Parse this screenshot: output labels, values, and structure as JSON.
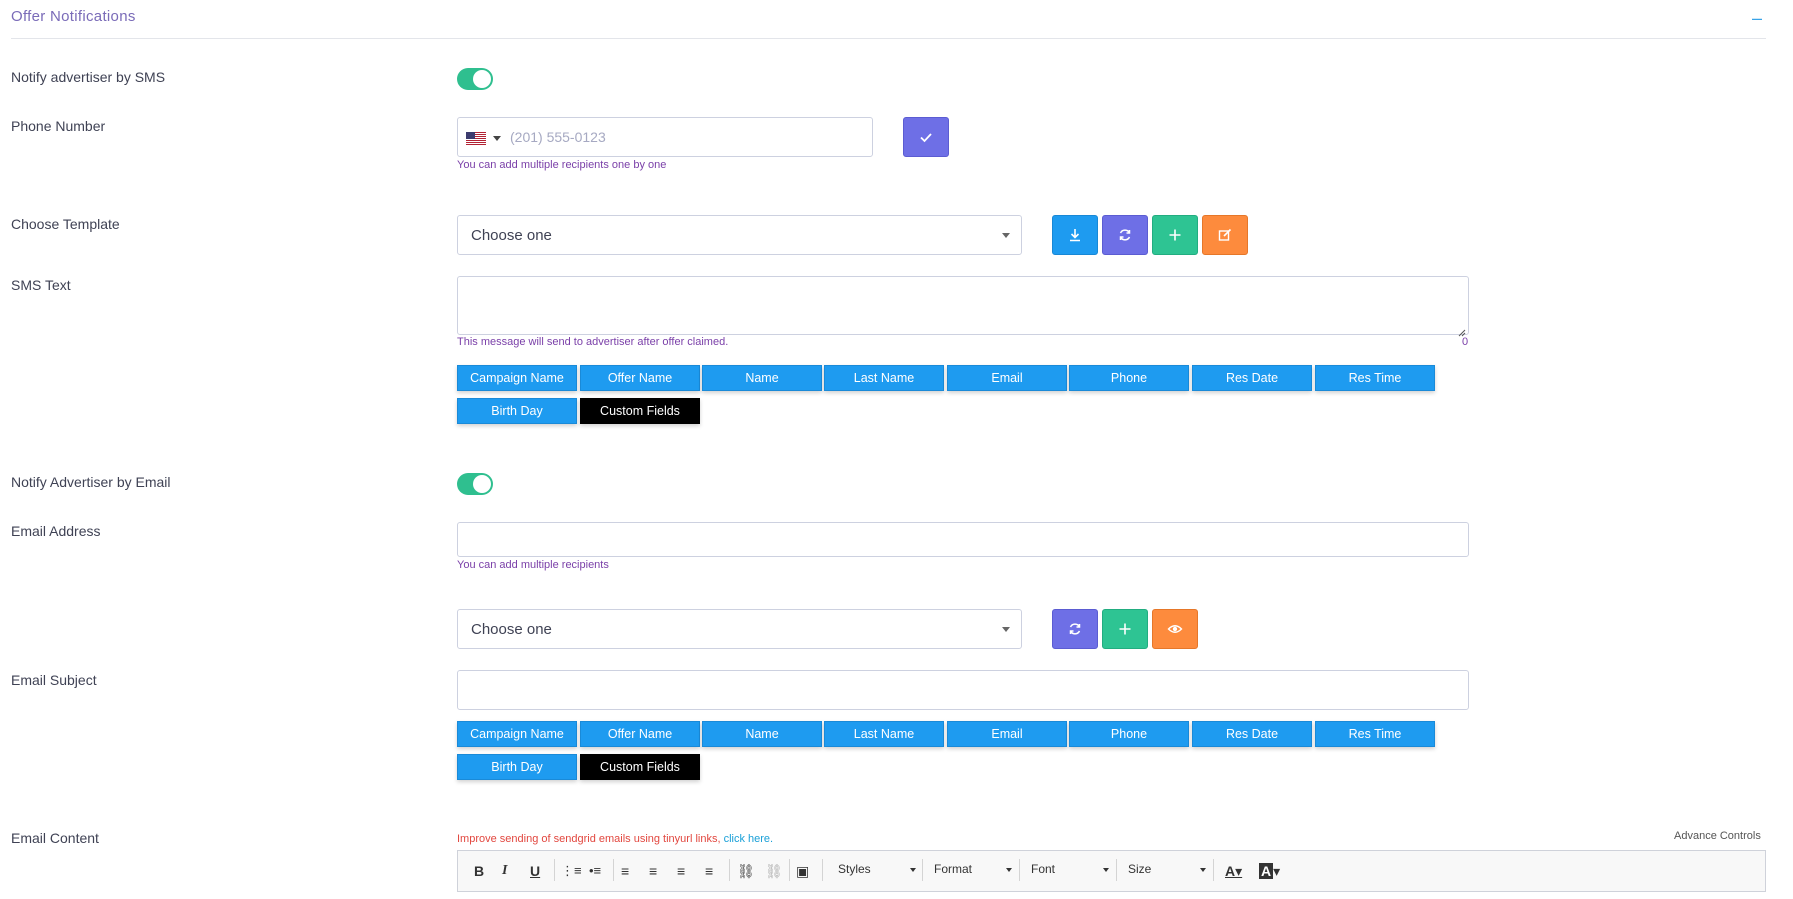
{
  "section": {
    "title": "Offer Notifications",
    "collapse_symbol": "–"
  },
  "sms": {
    "notify_label": "Notify advertiser by SMS",
    "notify_enabled": true,
    "phone_label": "Phone Number",
    "phone_placeholder": "(201) 555-0123",
    "phone_hint": "You can add multiple recipients one by one",
    "template_label": "Choose Template",
    "template_value": "Choose one",
    "text_label": "SMS Text",
    "text_value": "",
    "text_hint": "This message will send to advertiser after offer claimed.",
    "char_count": "0"
  },
  "tokens_row1": [
    "Campaign Name",
    "Offer Name",
    "Name",
    "Last Name",
    "Email",
    "Phone",
    "Res Date",
    "Res Time"
  ],
  "tokens_row2": [
    "Birth Day",
    "Custom Fields"
  ],
  "email": {
    "notify_label": "Notify Advertiser by Email",
    "notify_enabled": true,
    "address_label": "Email Address",
    "address_value": "",
    "address_hint": "You can add multiple recipients",
    "template_value": "Choose one",
    "subject_label": "Email Subject",
    "subject_value": "",
    "content_label": "Email Content",
    "tinyurl_notice": "Improve sending of sendgrid emails using tinyurl links,",
    "tinyurl_link": "click here.",
    "advance_controls": "Advance Controls"
  },
  "editor_toolbar": {
    "styles": "Styles",
    "format": "Format",
    "font": "Font",
    "size": "Size"
  },
  "colors": {
    "accent_blue": "#1e9bf0",
    "purple": "#6e6fe6",
    "green": "#2ec493",
    "orange": "#fd8b3d",
    "toggle_on": "#2fbf8f"
  }
}
